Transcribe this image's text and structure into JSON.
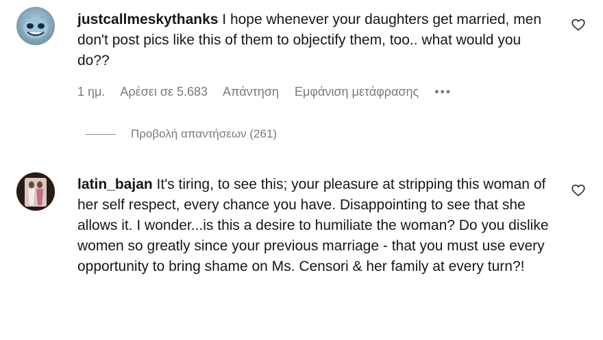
{
  "comments": [
    {
      "username": "justcallmeskythanks",
      "text": "I hope whenever your daughters get married, men don't post pics like this of them to objectify them, too.. what would you do??",
      "meta": {
        "time": "1 ημ.",
        "likes": "Αρέσει σε 5.683",
        "reply": "Απάντηση",
        "translate": "Εμφάνιση μετάφρασης",
        "more": "•••"
      },
      "view_replies": "Προβολή απαντήσεων (261)"
    },
    {
      "username": "latin_bajan",
      "text": "It's tiring, to see this; your pleasure at stripping this woman of her self respect, every chance you have. Disappointing to see that she allows it. I wonder...is this a desire to humiliate the woman? Do you dislike women so greatly since your previous marriage - that you must use every opportunity to bring shame on Ms. Censori & her family at every turn?!"
    }
  ],
  "icons": {
    "like": "heart-outline-icon",
    "more": "more-dots-icon"
  },
  "colors": {
    "text": "#161616",
    "muted": "#7a7a7a",
    "background": "#ffffff"
  }
}
